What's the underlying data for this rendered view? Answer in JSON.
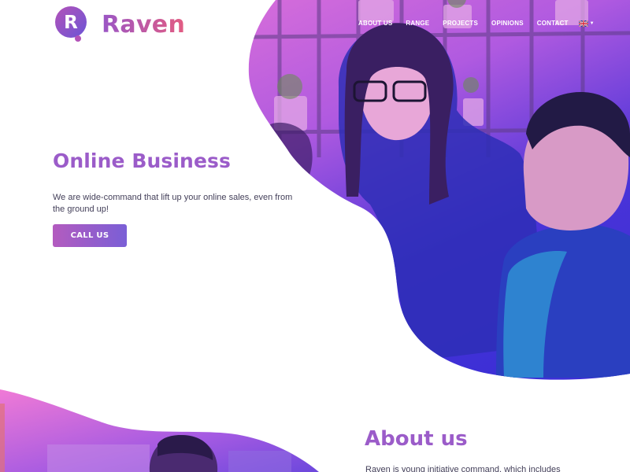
{
  "brand": {
    "name": "Raven",
    "logo_letter": "R"
  },
  "nav": {
    "items": [
      "ABOUT US",
      "RANGE",
      "PROJECTS",
      "OPINIONS",
      "CONTACT"
    ],
    "language_icon": "uk-flag-icon"
  },
  "hero": {
    "title": "Online Business",
    "description": "We are wide-command  that lift up your online sales, even from the ground up!",
    "cta_label": "CALL US",
    "image": "team-at-office-photo"
  },
  "about": {
    "title": "About us",
    "text": "Raven is young initiative command, which includes",
    "image": "person-at-computer-photo"
  },
  "colors": {
    "brand_purple": "#9b5cc9",
    "brand_pink": "#e35c82",
    "overlay_blue": "#3d2fd6",
    "overlay_pink": "#ee60c8",
    "text_dark": "#44405a"
  }
}
